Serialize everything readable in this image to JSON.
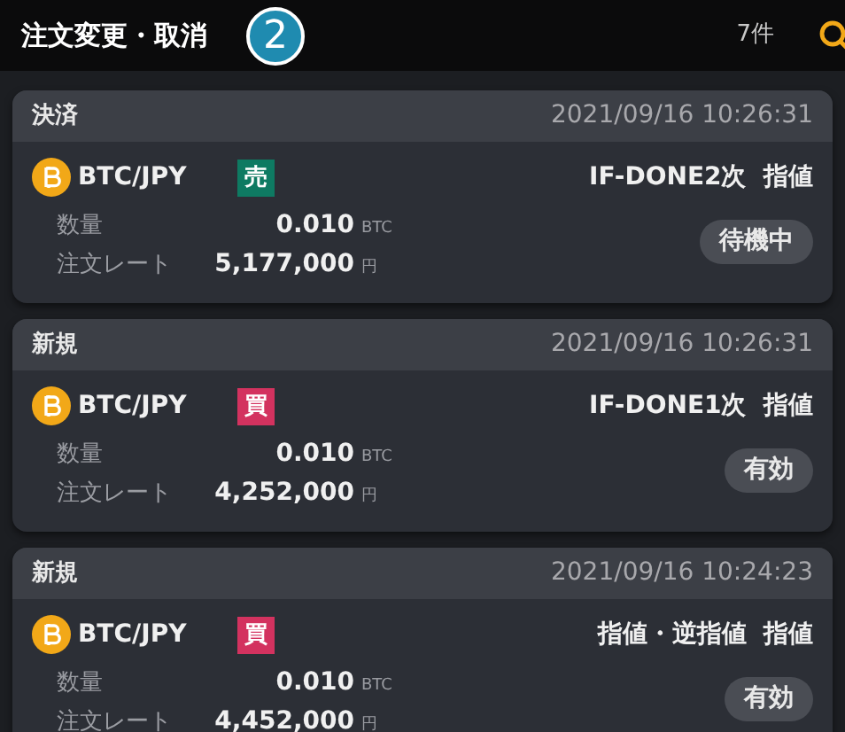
{
  "header": {
    "title": "注文変更・取消",
    "step_badge": "2",
    "count": "7件"
  },
  "orders": [
    {
      "type": "決済",
      "time": "2021/09/16 10:26:31",
      "pair": "BTC/JPY",
      "side": {
        "label": "売",
        "color": "#0e7a62"
      },
      "order_type": "IF-DONE2次  指値",
      "qty_label": "数量",
      "qty": "0.010",
      "qty_unit": "BTC",
      "rate_label": "注文レート",
      "rate": "5,177,000",
      "rate_unit": "円",
      "status": "待機中"
    },
    {
      "type": "新規",
      "time": "2021/09/16 10:26:31",
      "pair": "BTC/JPY",
      "side": {
        "label": "買",
        "color": "#d3325f"
      },
      "order_type": "IF-DONE1次  指値",
      "qty_label": "数量",
      "qty": "0.010",
      "qty_unit": "BTC",
      "rate_label": "注文レート",
      "rate": "4,252,000",
      "rate_unit": "円",
      "status": "有効"
    },
    {
      "type": "新規",
      "time": "2021/09/16 10:24:23",
      "pair": "BTC/JPY",
      "side": {
        "label": "買",
        "color": "#d3325f"
      },
      "order_type": "指値・逆指値  指値",
      "qty_label": "数量",
      "qty": "0.010",
      "qty_unit": "BTC",
      "rate_label": "注文レート",
      "rate": "4,452,000",
      "rate_unit": "円",
      "status": "有効"
    }
  ]
}
